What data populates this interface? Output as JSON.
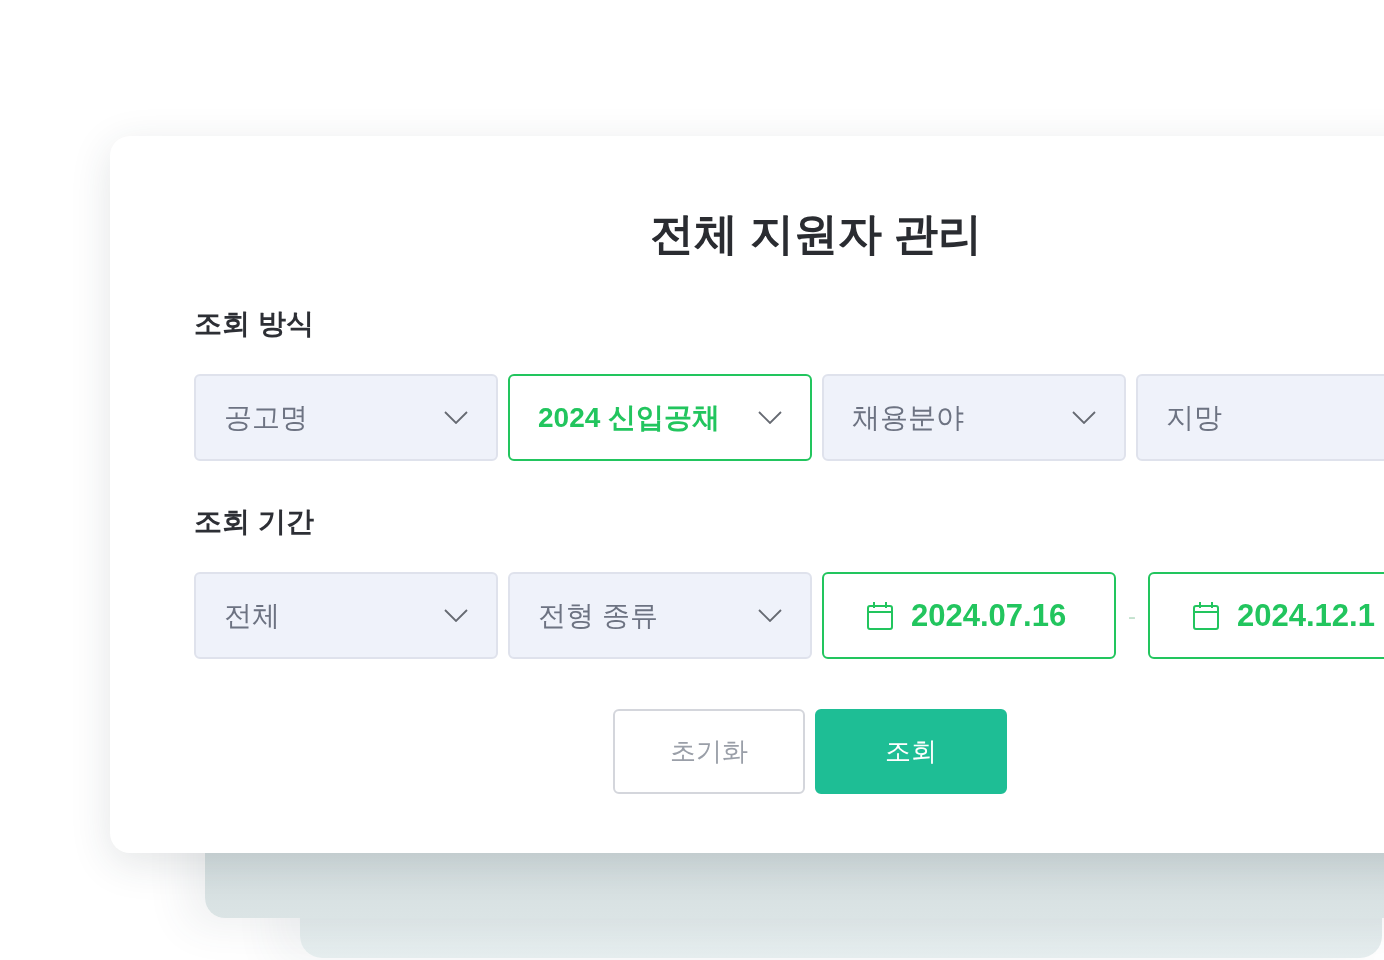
{
  "dialog": {
    "title": "전체 지원자 관리"
  },
  "sections": [
    {
      "label": "조회 방식",
      "fields": [
        {
          "kind": "select",
          "value": "공고명",
          "active": false,
          "caret": true
        },
        {
          "kind": "select",
          "value": "2024 신입공채",
          "active": true,
          "caret": true
        },
        {
          "kind": "select",
          "value": "채용분야",
          "active": false,
          "caret": true
        },
        {
          "kind": "select",
          "value": "지망",
          "active": false,
          "caret": false
        }
      ]
    },
    {
      "label": "조회 기간",
      "fields": [
        {
          "kind": "select",
          "value": "전체",
          "active": false,
          "caret": true
        },
        {
          "kind": "select",
          "value": "전형 종류",
          "active": false,
          "caret": true
        },
        {
          "kind": "date",
          "value": "2024.07.16",
          "active": true
        },
        {
          "kind": "separator",
          "value": "-"
        },
        {
          "kind": "date",
          "value": "2024.12.1",
          "active": true
        }
      ]
    }
  ],
  "buttons": [
    {
      "label": "초기화",
      "kind": "secondary"
    },
    {
      "label": "조회",
      "kind": "primary"
    }
  ]
}
